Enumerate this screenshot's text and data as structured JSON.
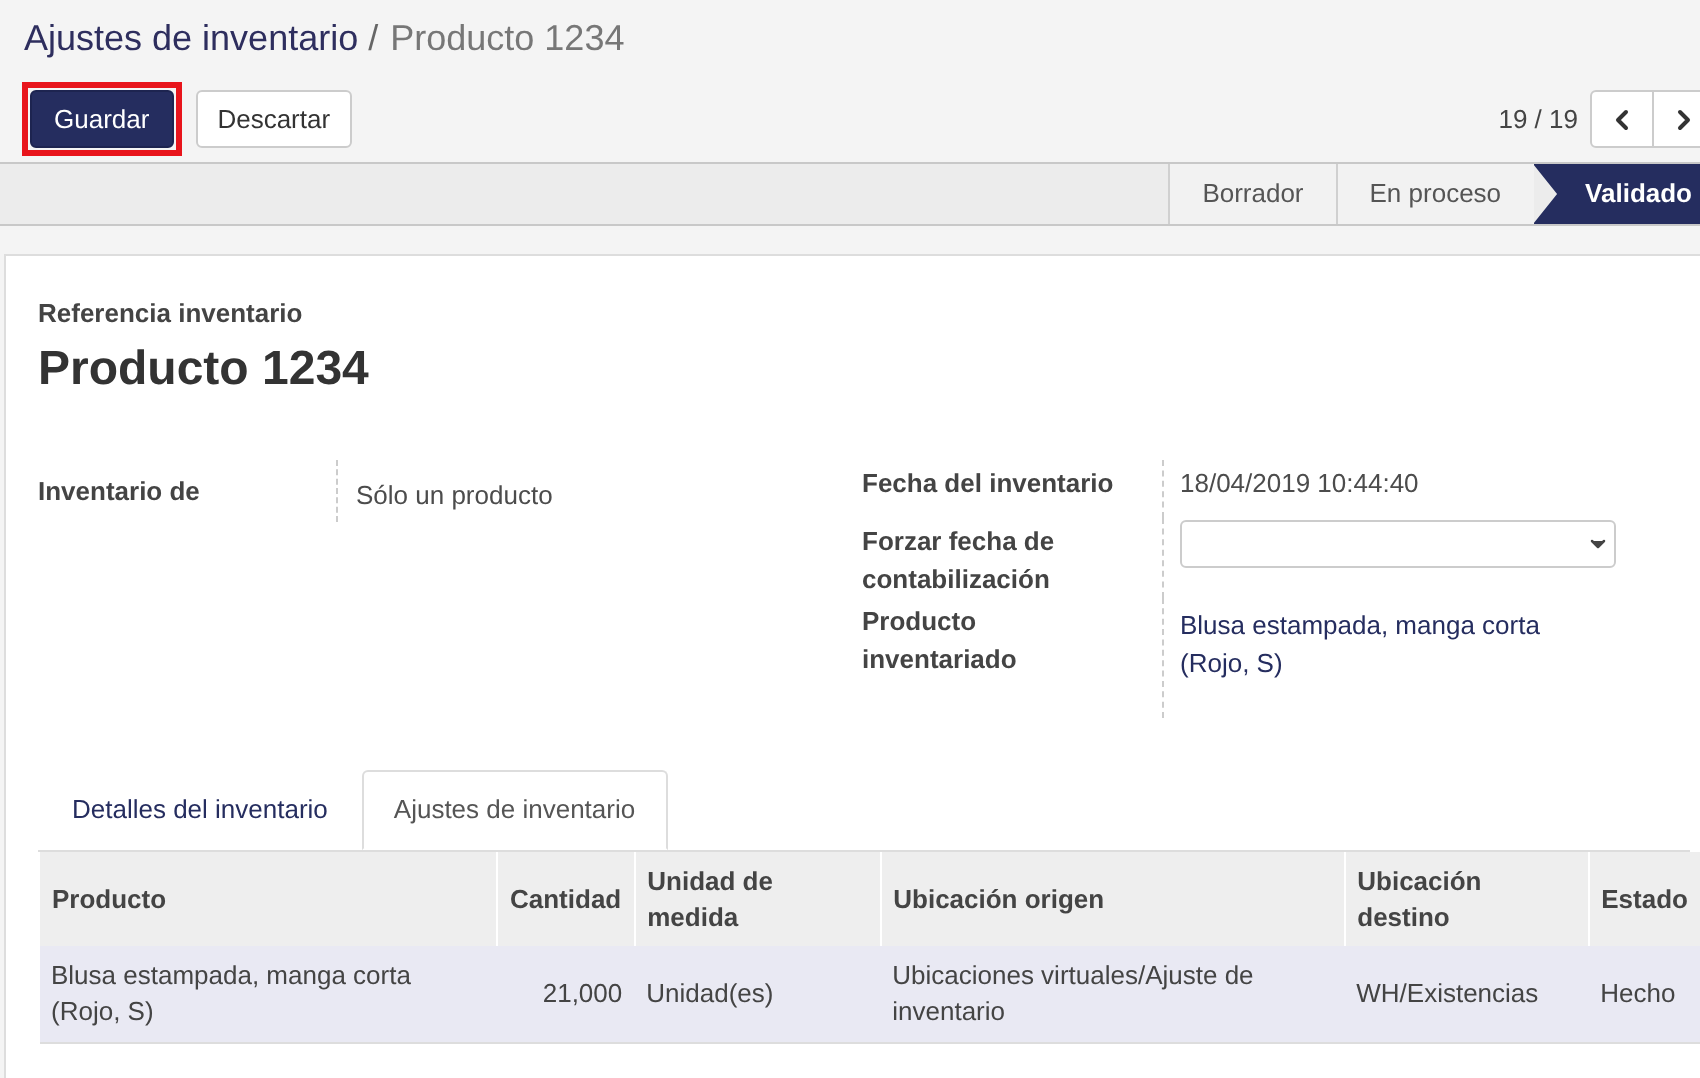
{
  "breadcrumb": {
    "parent": "Ajustes de inventario",
    "separator": "/",
    "current": "Producto 1234"
  },
  "buttons": [
    {
      "label": "Guardar",
      "kind": "primary",
      "highlighted": true
    },
    {
      "label": "Descartar",
      "kind": "secondary",
      "highlighted": false
    }
  ],
  "pager": {
    "text": "19 / 19"
  },
  "status_bar": [
    {
      "label": "Borrador",
      "selected": false
    },
    {
      "label": "En proceso",
      "selected": false
    },
    {
      "label": "Validado",
      "selected": true
    }
  ],
  "form": {
    "reference_label": "Referencia inventario",
    "reference": "Producto 1234",
    "left_fields": [
      {
        "label": "Inventario de",
        "value": "Sólo un producto"
      }
    ],
    "right_fields": [
      {
        "label": "Fecha del inventario",
        "value": "18/04/2019 10:44:40",
        "kind": "text"
      },
      {
        "label": "Forzar fecha de contabilización",
        "kind": "select"
      },
      {
        "label": "Producto inventariado",
        "value": "Blusa estampada, manga corta (Rojo, S)",
        "kind": "link"
      }
    ]
  },
  "tabs": [
    {
      "label": "Detalles del inventario",
      "selected": false
    },
    {
      "label": "Ajustes de inventario",
      "selected": true
    }
  ],
  "table": {
    "columns": [
      "Producto",
      "Cantidad",
      "Unidad de medida",
      "Ubicación origen",
      "Ubicación destino",
      "Estado"
    ],
    "rows": [
      [
        "Blusa estampada, manga corta (Rojo, S)",
        "21,000",
        "Unidad(es)",
        "Ubicaciones virtuales/Ajuste de inventario",
        "WH/Existencias",
        "Hecho"
      ]
    ]
  }
}
